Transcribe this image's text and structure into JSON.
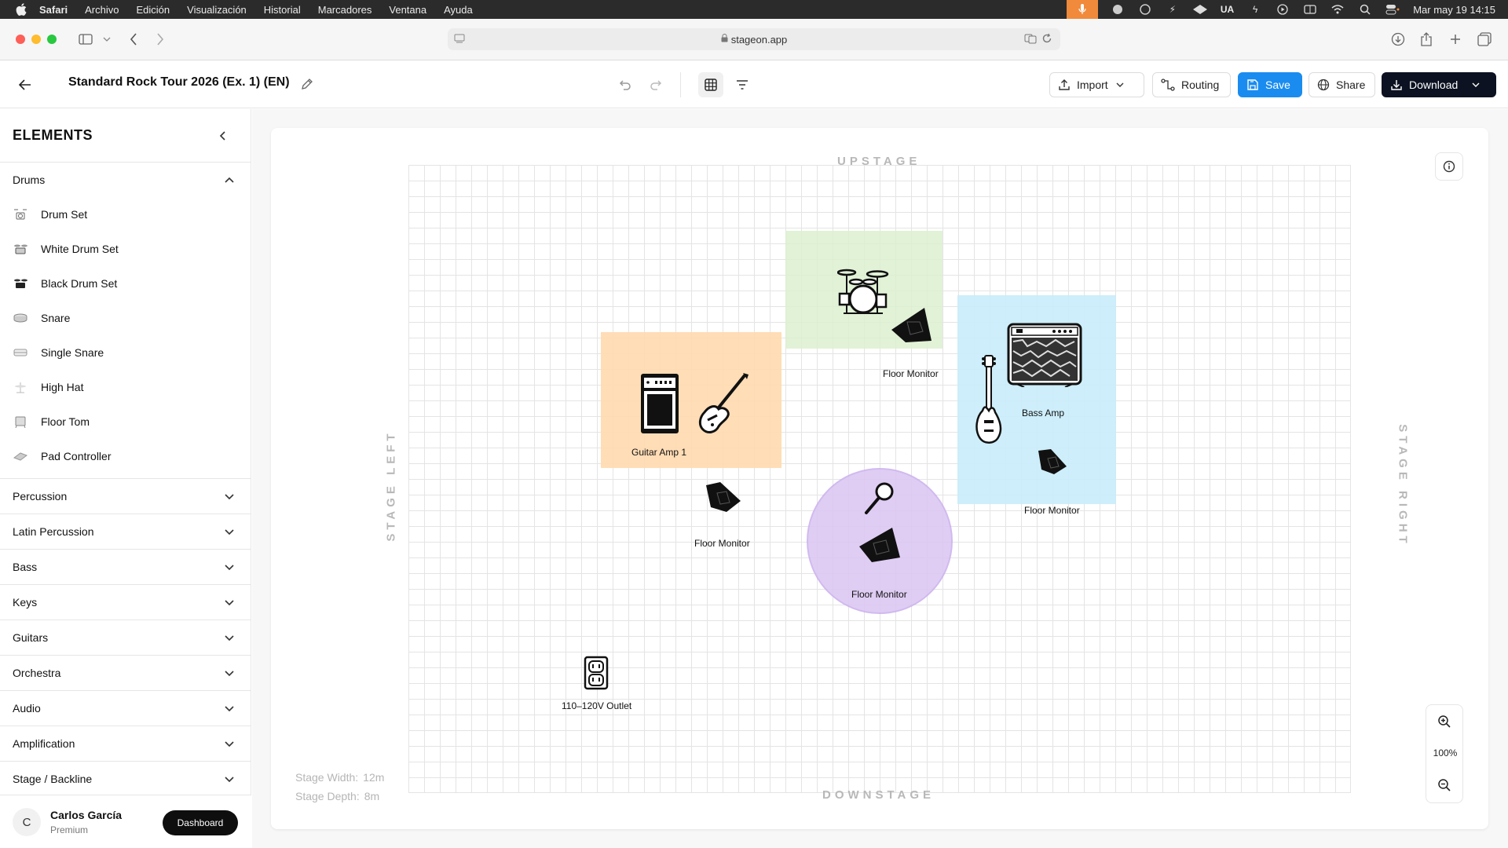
{
  "menubar": {
    "app": "Safari",
    "items": [
      "Archivo",
      "Edición",
      "Visualización",
      "Historial",
      "Marcadores",
      "Ventana",
      "Ayuda"
    ],
    "status_ua": "UA",
    "clock": "Mar may 19  14:15"
  },
  "browser": {
    "url": "stageon.app"
  },
  "toolbar": {
    "title": "Standard Rock Tour 2026 (Ex. 1) (EN)",
    "import_label": "Import",
    "routing_label": "Routing",
    "save_label": "Save",
    "share_label": "Share",
    "download_label": "Download"
  },
  "sidebar": {
    "title": "ELEMENTS",
    "open_category": "Drums",
    "drum_items": [
      {
        "label": "Drum Set",
        "icon": "drum-set-icon"
      },
      {
        "label": "White Drum Set",
        "icon": "white-drum-set-icon"
      },
      {
        "label": "Black Drum Set",
        "icon": "black-drum-set-icon"
      },
      {
        "label": "Snare",
        "icon": "snare-icon"
      },
      {
        "label": "Single Snare",
        "icon": "single-snare-icon"
      },
      {
        "label": "High Hat",
        "icon": "high-hat-icon"
      },
      {
        "label": "Floor Tom",
        "icon": "floor-tom-icon"
      },
      {
        "label": "Pad Controller",
        "icon": "pad-controller-icon"
      }
    ],
    "categories": [
      "Percussion",
      "Latin Percussion",
      "Bass",
      "Keys",
      "Guitars",
      "Orchestra",
      "Audio",
      "Amplification",
      "Stage / Backline"
    ]
  },
  "user": {
    "initial": "C",
    "name": "Carlos García",
    "plan": "Premium",
    "dashboard_label": "Dashboard"
  },
  "stage": {
    "upstage": "UPSTAGE",
    "downstage": "DOWNSTAGE",
    "stage_left": "STAGE LEFT",
    "stage_right": "STAGE RIGHT",
    "width_label": "Stage Width:",
    "width_value": "12m",
    "depth_label": "Stage Depth:",
    "depth_value": "8m",
    "zoom": "100%",
    "zone_colors": {
      "drums": "#dcf0d0",
      "guitar": "#ffd9ae",
      "bass": "#c8ecfa",
      "vocal": "#dcc8f3"
    },
    "labels": {
      "floor_monitor_drums": "Floor Monitor",
      "bass_amp": "Bass Amp",
      "guitar_amp": "Guitar Amp 1",
      "floor_monitor_left": "Floor Monitor",
      "floor_monitor_bass": "Floor Monitor",
      "floor_monitor_vocal": "Floor Monitor",
      "outlet": "110–120V Outlet"
    }
  }
}
